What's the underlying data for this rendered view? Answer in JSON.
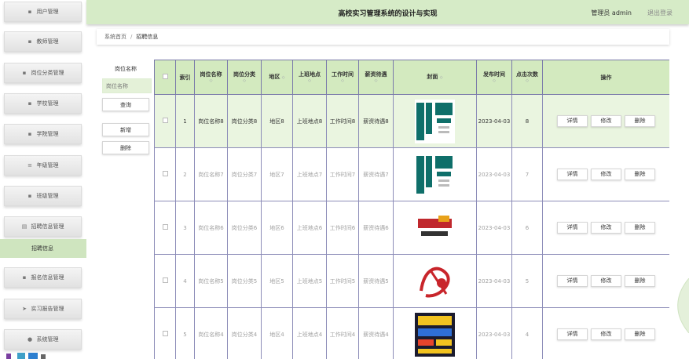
{
  "header": {
    "title": "高校实习管理系统的设计与实现",
    "user": "管理员 admin",
    "logout": "退出登录"
  },
  "sidebar": {
    "items": [
      {
        "label": "用户管理",
        "icon": "grid-icon"
      },
      {
        "label": "教师管理",
        "icon": "grid-icon"
      },
      {
        "label": "岗位分类管理",
        "icon": "grid-icon"
      },
      {
        "label": "学校管理",
        "icon": "grid-icon"
      },
      {
        "label": "学院管理",
        "icon": "grid-icon"
      },
      {
        "label": "年级管理",
        "icon": "list-icon"
      },
      {
        "label": "班级管理",
        "icon": "grid-icon"
      },
      {
        "label": "招聘信息管理",
        "icon": "document-icon"
      },
      {
        "label": "招聘信息",
        "icon": ""
      },
      {
        "label": "报名信息管理",
        "icon": "grid-icon"
      },
      {
        "label": "实习报告管理",
        "icon": "send-icon"
      },
      {
        "label": "系统管理",
        "icon": "location-icon"
      }
    ]
  },
  "breadcrumb": {
    "home": "系统首页",
    "sep": "/",
    "current": "招聘信息"
  },
  "search": {
    "label": "岗位名称",
    "placeholder": "岗位名称",
    "query_button": "查询",
    "add_button": "新增",
    "delete_button": "删除"
  },
  "table": {
    "headers": {
      "index": "索引",
      "name": "岗位名称",
      "category": "岗位分类",
      "region": "地区",
      "location": "上班地点",
      "hours": "工作时间",
      "salary": "薪资待遇",
      "cover": "封面",
      "date": "发布时间",
      "clicks": "点击次数",
      "ops": "操作"
    },
    "sort_glyph": "◇",
    "rows": [
      {
        "index": "1",
        "name": "岗位名称8",
        "category": "岗位分类8",
        "region": "地区8",
        "location": "上班地点8",
        "hours": "工作时间8",
        "salary": "薪资待遇8",
        "date": "2023-04-03",
        "clicks": "8",
        "poster": "poster-zhaopin-teal"
      },
      {
        "index": "2",
        "name": "岗位名称7",
        "category": "岗位分类7",
        "region": "地区7",
        "location": "上班地点7",
        "hours": "工作时间7",
        "salary": "薪资待遇7",
        "date": "2023-04-03",
        "clicks": "7",
        "poster": "poster-zhaopin-teal"
      },
      {
        "index": "3",
        "name": "岗位名称6",
        "category": "岗位分类6",
        "region": "地区6",
        "location": "上班地点6",
        "hours": "工作时间6",
        "salary": "薪资待遇6",
        "date": "2023-04-03",
        "clicks": "6",
        "poster": "poster-chengpin-yingcai"
      },
      {
        "index": "4",
        "name": "岗位名称5",
        "category": "岗位分类5",
        "region": "地区5",
        "location": "上班地点5",
        "hours": "工作时间5",
        "salary": "薪资待遇5",
        "date": "2023-04-03",
        "clicks": "5",
        "poster": "poster-zhaopin-red"
      },
      {
        "index": "5",
        "name": "岗位名称4",
        "category": "岗位分类4",
        "region": "地区4",
        "location": "上班地点4",
        "hours": "工作时间4",
        "salary": "薪资待遇4",
        "date": "2023-04-03",
        "clicks": "4",
        "poster": "poster-zhaopin-haibao"
      }
    ],
    "row_actions": {
      "detail": "详情",
      "edit": "修改",
      "delete": "删除"
    }
  },
  "colors": {
    "accent_green": "#d6ebc7",
    "header_green": "#d3eabf",
    "active_row": "#eaf5e0",
    "border": "#8c8cb8"
  }
}
